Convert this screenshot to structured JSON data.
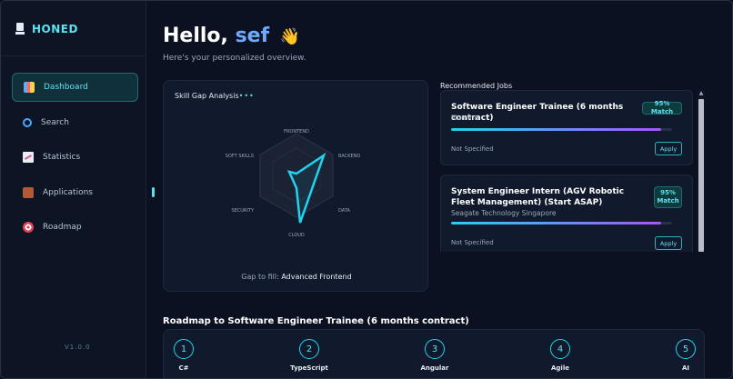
{
  "brand": {
    "name": "HONED"
  },
  "sidebar": {
    "items": [
      {
        "label": "Dashboard",
        "icon": "dashboard-icon",
        "active": true
      },
      {
        "label": "Search",
        "icon": "search-icon",
        "active": false
      },
      {
        "label": "Statistics",
        "icon": "statistics-icon",
        "active": false
      },
      {
        "label": "Applications",
        "icon": "briefcase-icon",
        "active": false
      },
      {
        "label": "Roadmap",
        "icon": "target-icon",
        "active": false
      }
    ],
    "version": "V1.0.0"
  },
  "header": {
    "greeting": "Hello,",
    "user_name": "sef",
    "wave": "👋",
    "subtitle": "Here's your personalized overview."
  },
  "skill_gap": {
    "title": "Skill Gap Analysis",
    "dots": "•••",
    "axes": [
      "FRONTEND",
      "BACKEND",
      "DATA",
      "CLOUD",
      "SECURITY",
      "SOFT SKILLS"
    ],
    "gap_prefix": "Gap to fill:",
    "gap_value": "Advanced Frontend"
  },
  "jobs": {
    "heading": "Recommended Jobs",
    "items": [
      {
        "title": "Software Engineer Trainee (6 months contract)",
        "company": "Illumina",
        "match": "95% Match",
        "match_pct": 95,
        "location": "Not Specified",
        "apply_label": "Apply"
      },
      {
        "title": "System Engineer Intern (AGV Robotic Fleet Management) (Start ASAP)",
        "company": "Seagate Technology Singapore",
        "match": "95% Match",
        "match_pct": 95,
        "location": "Not Specified",
        "apply_label": "Apply"
      }
    ]
  },
  "roadmap": {
    "title": "Roadmap to Software Engineer Trainee (6 months contract)",
    "steps": [
      {
        "number": "1",
        "label": "C#"
      },
      {
        "number": "2",
        "label": "TypeScript"
      },
      {
        "number": "3",
        "label": "Angular"
      },
      {
        "number": "4",
        "label": "Agile"
      },
      {
        "number": "5",
        "label": "AI"
      }
    ]
  },
  "colors": {
    "accent": "#22d3ee",
    "accent_purple": "#a855f7",
    "background": "#0b1120",
    "card": "#111a2c"
  }
}
